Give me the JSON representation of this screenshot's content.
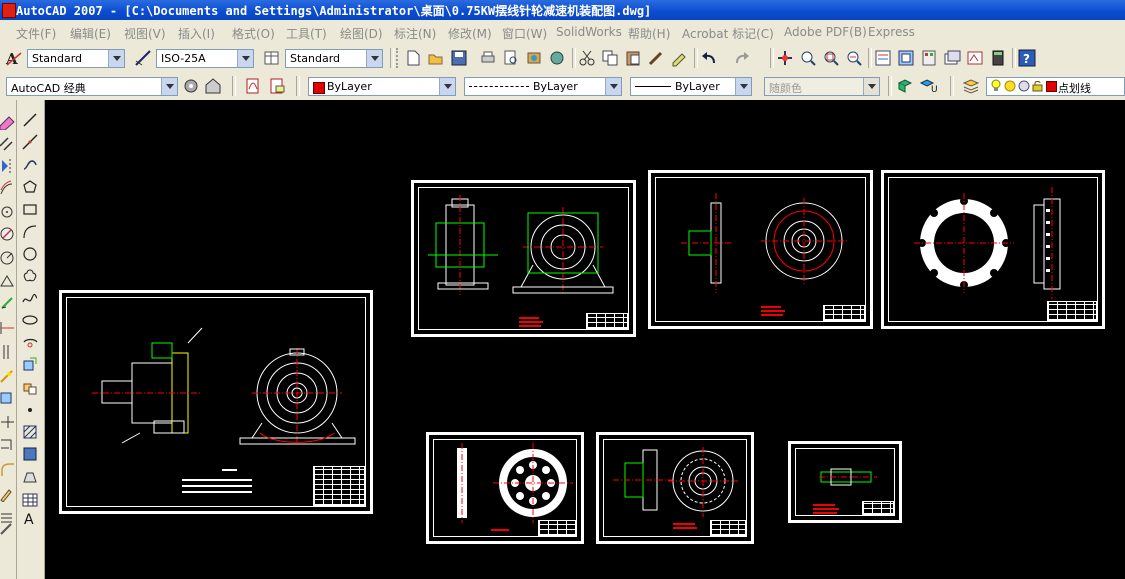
{
  "window": {
    "title": "AutoCAD 2007 - [C:\\Documents and Settings\\Administrator\\桌面\\0.75KW摆线针轮减速机装配图.dwg]"
  },
  "menu": {
    "items": [
      {
        "label": "文件(F)"
      },
      {
        "label": "编辑(E)"
      },
      {
        "label": "视图(V)"
      },
      {
        "label": "插入(I)"
      },
      {
        "label": "格式(O)"
      },
      {
        "label": "工具(T)"
      },
      {
        "label": "绘图(D)"
      },
      {
        "label": "标注(N)"
      },
      {
        "label": "修改(M)"
      },
      {
        "label": "窗口(W)"
      },
      {
        "label": "SolidWorks"
      },
      {
        "label": "帮助(H)"
      },
      {
        "label": "Acrobat 标记(C)"
      },
      {
        "label": "Adobe PDF(B)"
      },
      {
        "label": "Express"
      }
    ]
  },
  "styles_toolbar": {
    "text_style": "Standard",
    "dim_style": "ISO-25A",
    "table_style": "Standard"
  },
  "workspace_toolbar": {
    "workspace": "AutoCAD 经典"
  },
  "properties_toolbar": {
    "color": "ByLayer",
    "linetype": "ByLayer",
    "lineweight": "ByLayer",
    "plot_style": "随颜色",
    "color_swatch": "#e00000"
  },
  "layers_toolbar": {
    "current_layer": "点划线"
  },
  "colors": {
    "drawing_background": "#000000",
    "geometry_white": "#ffffff",
    "geometry_red": "#ff0000",
    "geometry_green": "#00ff00",
    "geometry_yellow": "#ffff00"
  }
}
